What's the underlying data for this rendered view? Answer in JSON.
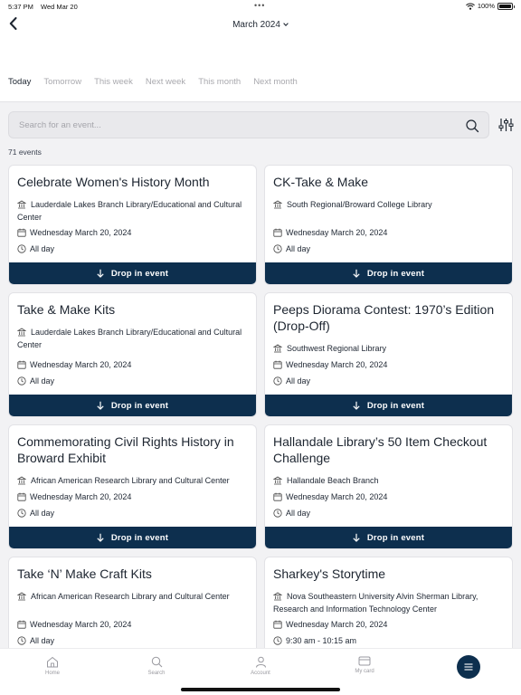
{
  "status_bar": {
    "time": "5:37 PM",
    "date": "Wed Mar 20",
    "battery": "100%"
  },
  "header": {
    "month_label": "March 2024"
  },
  "tabs": [
    {
      "label": "Today",
      "active": true
    },
    {
      "label": "Tomorrow",
      "active": false
    },
    {
      "label": "This week",
      "active": false
    },
    {
      "label": "Next week",
      "active": false
    },
    {
      "label": "This month",
      "active": false
    },
    {
      "label": "Next month",
      "active": false
    }
  ],
  "search": {
    "placeholder": "Search for an event..."
  },
  "results": {
    "count_label": "71 events"
  },
  "events": [
    {
      "title": "Celebrate Women's History Month",
      "location": "Lauderdale Lakes Branch Library/Educational and Cultural Center",
      "date": "Wednesday March 20, 2024",
      "time": "All day",
      "button": "Drop in event"
    },
    {
      "title": "CK-Take & Make",
      "location": "South Regional/Broward College Library",
      "date": "Wednesday March 20, 2024",
      "time": "All day",
      "button": "Drop in event"
    },
    {
      "title": "Take & Make Kits",
      "location": "Lauderdale Lakes Branch Library/Educational and Cultural Center",
      "date": "Wednesday March 20, 2024",
      "time": "All day",
      "button": "Drop in event"
    },
    {
      "title": "Peeps Diorama Contest: 1970’s Edition (Drop-Off)",
      "location": "Southwest Regional Library",
      "date": "Wednesday March 20, 2024",
      "time": "All day",
      "button": "Drop in event"
    },
    {
      "title": "Commemorating Civil Rights History in Broward Exhibit",
      "location": "African American Research Library and Cultural Center",
      "date": "Wednesday March 20, 2024",
      "time": "All day",
      "button": "Drop in event"
    },
    {
      "title": "Hallandale Library’s 50 Item Checkout Challenge",
      "location": "Hallandale Beach Branch",
      "date": "Wednesday March 20, 2024",
      "time": "All day",
      "button": "Drop in event"
    },
    {
      "title": "Take ‘N’ Make Craft Kits",
      "location": "African American Research Library and Cultural Center",
      "date": "Wednesday March 20, 2024",
      "time": "All day",
      "button": ""
    },
    {
      "title": "Sharkey's Storytime",
      "location": "Nova Southeastern University Alvin Sherman Library, Research and Information Technology Center",
      "date": "Wednesday March 20, 2024",
      "time": "9:30 am - 10:15 am",
      "button": ""
    }
  ],
  "bottom_nav": {
    "items": [
      {
        "label": "Home",
        "icon": "home-icon"
      },
      {
        "label": "Search",
        "icon": "search-icon"
      },
      {
        "label": "Account",
        "icon": "account-icon"
      },
      {
        "label": "My card",
        "icon": "card-icon"
      }
    ],
    "menu_icon": "menu-icon"
  },
  "colors": {
    "accent": "#0d2f4e",
    "muted": "#a9a9ae",
    "background": "#f2f2f4"
  }
}
